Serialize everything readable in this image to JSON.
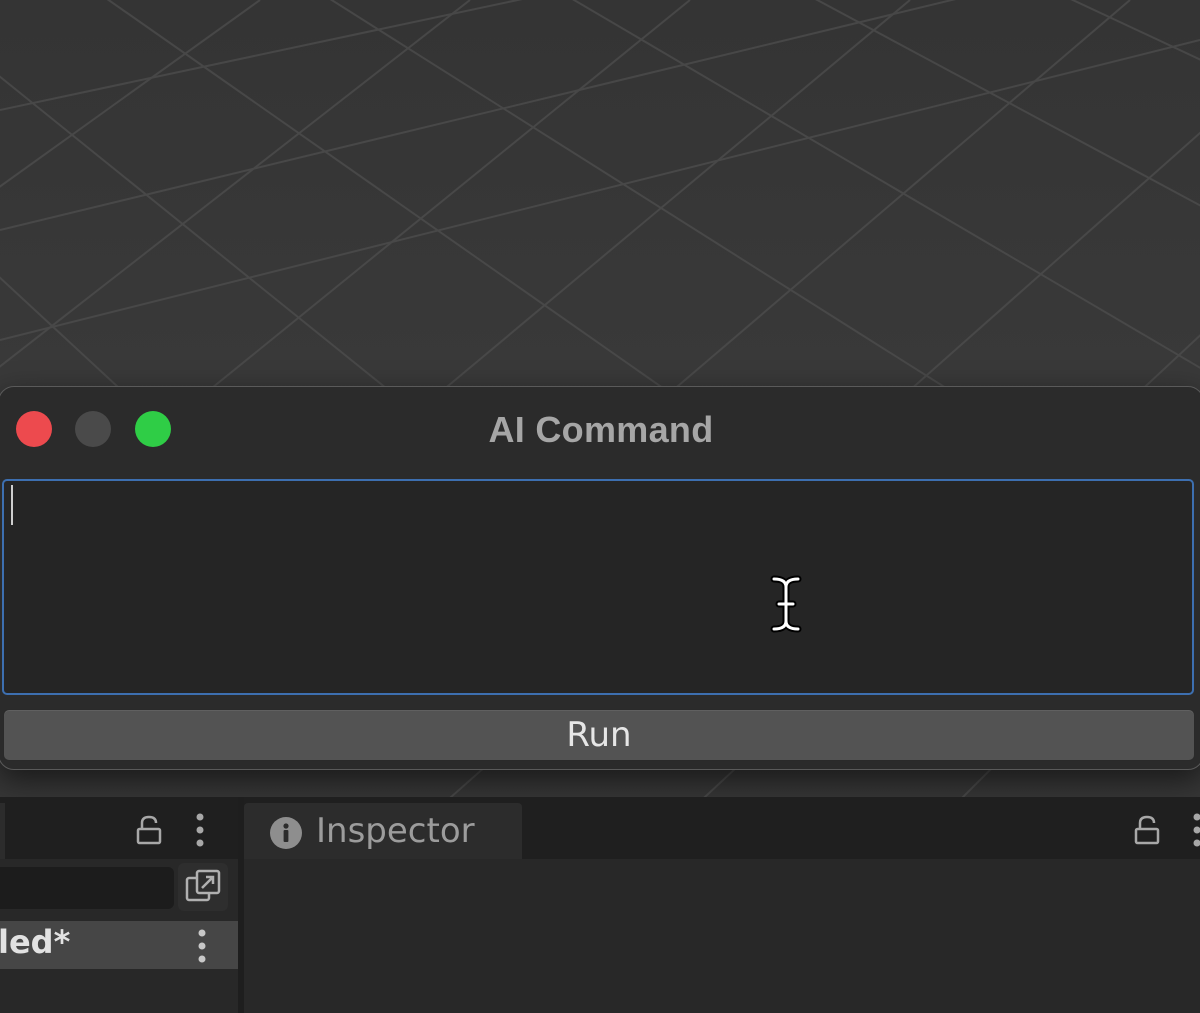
{
  "window": {
    "title": "AI Command",
    "input_value": "",
    "run_label": "Run"
  },
  "panels": {
    "left": {
      "scene_row_label": "led*"
    },
    "inspector": {
      "tab_label": "Inspector"
    }
  },
  "colors": {
    "close": "#ed4a4e",
    "minimize": "#4a4a4a",
    "zoom": "#2fcd46",
    "focus_border": "#3d6fb0"
  },
  "icons": [
    "close-icon",
    "minimize-icon",
    "zoom-icon",
    "text-cursor-icon",
    "lock-icon",
    "kebab-menu-icon",
    "expand-icon",
    "info-icon"
  ]
}
